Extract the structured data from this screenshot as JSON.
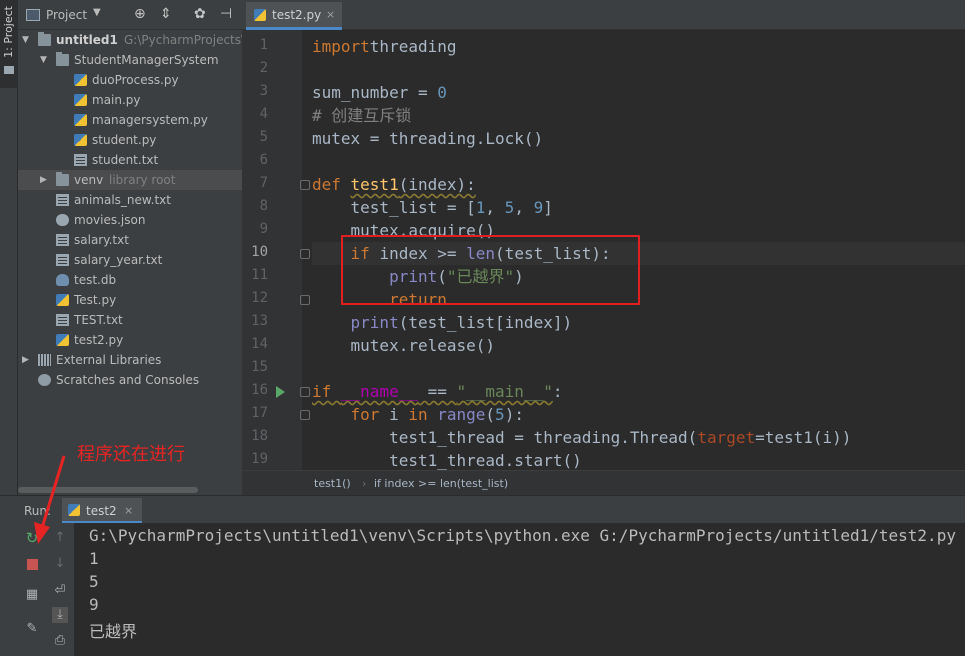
{
  "sidebar_tab": {
    "label": "1: Project"
  },
  "project_panel": {
    "title": "Project",
    "tree": [
      {
        "label": "untitled1",
        "extra": "G:\\PycharmProjects\\u",
        "type": "folder",
        "depth": 0,
        "expanded": true
      },
      {
        "label": "StudentManagerSystem",
        "type": "folder",
        "depth": 1,
        "expanded": true
      },
      {
        "label": "duoProcess.py",
        "type": "py",
        "depth": 2
      },
      {
        "label": "main.py",
        "type": "py",
        "depth": 2
      },
      {
        "label": "managersystem.py",
        "type": "py",
        "depth": 2
      },
      {
        "label": "student.py",
        "type": "py",
        "depth": 2
      },
      {
        "label": "student.txt",
        "type": "txt",
        "depth": 2
      },
      {
        "label": "venv",
        "extra": "library root",
        "type": "folder",
        "depth": 1,
        "expanded": false,
        "selected": true
      },
      {
        "label": "animals_new.txt",
        "type": "txt",
        "depth": 1
      },
      {
        "label": "movies.json",
        "type": "json",
        "depth": 1
      },
      {
        "label": "salary.txt",
        "type": "txt",
        "depth": 1
      },
      {
        "label": "salary_year.txt",
        "type": "txt",
        "depth": 1
      },
      {
        "label": "test.db",
        "type": "db",
        "depth": 1
      },
      {
        "label": "Test.py",
        "type": "py",
        "depth": 1
      },
      {
        "label": "TEST.txt",
        "type": "txt",
        "depth": 1
      },
      {
        "label": "test2.py",
        "type": "py",
        "depth": 1
      },
      {
        "label": "External Libraries",
        "type": "lib",
        "depth": 0,
        "expanded": false
      },
      {
        "label": "Scratches and Consoles",
        "type": "scratch",
        "depth": 0
      }
    ]
  },
  "editor": {
    "tab": {
      "label": "test2.py",
      "close": "×"
    },
    "current_line": 10,
    "run_marker_line": 16,
    "fold_lines": [
      7,
      10,
      12,
      16,
      17
    ],
    "highlight_lines": [
      10,
      12
    ],
    "lines": [
      [
        [
          "kw",
          "import"
        ],
        [
          "",
          "threading"
        ]
      ],
      [],
      [
        [
          "",
          "sum_number = "
        ],
        [
          "num",
          "0"
        ]
      ],
      [
        [
          "cmt",
          "# 创建互斥锁"
        ]
      ],
      [
        [
          "",
          "mutex = threading.Lock()"
        ]
      ],
      [],
      [
        [
          "kw",
          "def "
        ],
        [
          "fn sq",
          "test1"
        ],
        [
          "sq",
          "(index):"
        ]
      ],
      [
        [
          "",
          "    test_list = ["
        ],
        [
          "num",
          "1"
        ],
        [
          "",
          ", "
        ],
        [
          "num",
          "5"
        ],
        [
          "",
          ", "
        ],
        [
          "num",
          "9"
        ],
        [
          "",
          "]"
        ]
      ],
      [
        [
          "",
          "    mutex.acquire()"
        ]
      ],
      [
        [
          "kw",
          "    if "
        ],
        [
          "",
          "index >= "
        ],
        [
          "bi",
          "len"
        ],
        [
          "",
          "(test_list):"
        ]
      ],
      [
        [
          "bi",
          "        print"
        ],
        [
          "",
          "("
        ],
        [
          "str",
          "\"已越界\""
        ],
        [
          "",
          ")"
        ]
      ],
      [
        [
          "kw",
          "        return"
        ]
      ],
      [
        [
          "bi",
          "    print"
        ],
        [
          "",
          "(test_list[index])"
        ]
      ],
      [
        [
          "",
          "    mutex.release()"
        ]
      ],
      [],
      [
        [
          "kw sq",
          "if "
        ],
        [
          "mag sq",
          "__name__"
        ],
        [
          "sq",
          " == "
        ],
        [
          "str sq",
          "\"__main__\""
        ],
        [
          "",
          ":"
        ]
      ],
      [
        [
          "kw",
          "    for "
        ],
        [
          "",
          "i "
        ],
        [
          "kw",
          "in "
        ],
        [
          "bi",
          "range"
        ],
        [
          "",
          "("
        ],
        [
          "num",
          "5"
        ],
        [
          "",
          "):"
        ]
      ],
      [
        [
          "",
          "        test1_thread = threading.Thread("
        ],
        [
          "par",
          "target"
        ],
        [
          "",
          "=test1(i))"
        ]
      ],
      [
        [
          "",
          "        test1_thread.start()"
        ]
      ]
    ],
    "breadcrumb": [
      "test1()",
      "if index >= len(test_list)"
    ]
  },
  "annotation": {
    "text": "程序还在进行"
  },
  "run_panel": {
    "label": "Run:",
    "tab": {
      "label": "test2",
      "close": "×"
    },
    "console": [
      "G:\\PycharmProjects\\untitled1\\venv\\Scripts\\python.exe G:/PycharmProjects/untitled1/test2.py",
      "1",
      "5",
      "9",
      "已越界"
    ]
  },
  "colors": {
    "panel": "#3c3f41",
    "editor_bg": "#2b2b2b",
    "keyword": "#cc7832",
    "number": "#6897bb",
    "string": "#6a8759",
    "function": "#ffc66d",
    "highlight_box": "#e02020",
    "annotation": "#e62424",
    "stop": "#c75450",
    "run_green": "#59a869"
  }
}
